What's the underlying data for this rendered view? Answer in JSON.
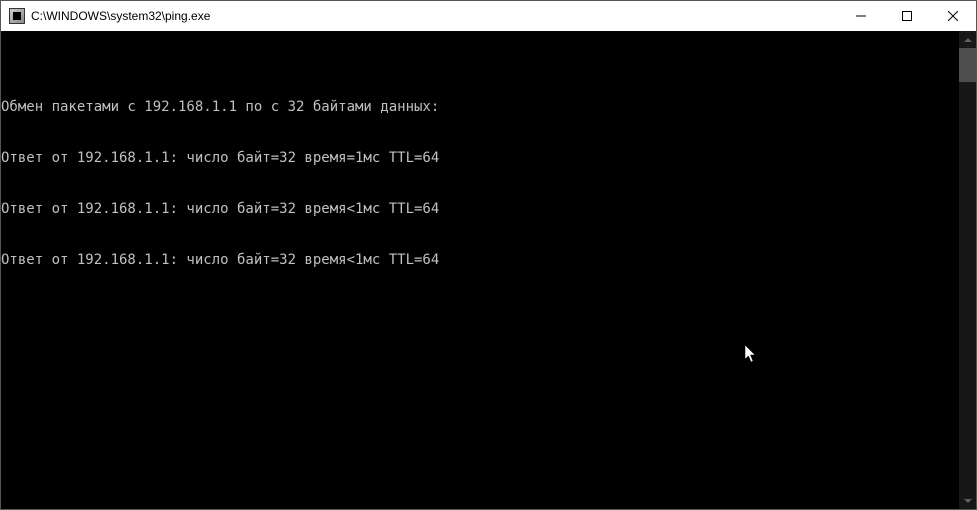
{
  "window": {
    "title": "C:\\WINDOWS\\system32\\ping.exe"
  },
  "console": {
    "lines": [
      "",
      "Обмен пакетами с 192.168.1.1 по с 32 байтами данных:",
      "Ответ от 192.168.1.1: число байт=32 время=1мс TTL=64",
      "Ответ от 192.168.1.1: число байт=32 время<1мс TTL=64",
      "Ответ от 192.168.1.1: число байт=32 время<1мс TTL=64"
    ]
  }
}
